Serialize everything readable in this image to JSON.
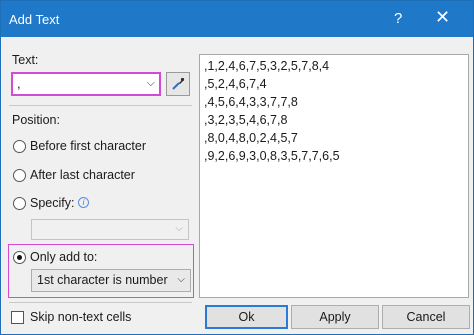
{
  "window": {
    "title": "Add Text",
    "help_symbol": "?",
    "close_symbol": "✕"
  },
  "text_section": {
    "label": "Text:",
    "value": ",",
    "dropdown_arrow": "⌵"
  },
  "position_section": {
    "label": "Position:",
    "options": [
      {
        "label": "Before first character",
        "checked": false
      },
      {
        "label": "After last character",
        "checked": false
      },
      {
        "label": "Specify:",
        "checked": false
      },
      {
        "label": "Only add to:",
        "checked": true
      }
    ],
    "specify_value": "",
    "only_add_to_value": "1st character is number"
  },
  "skip_non_text": {
    "label": "Skip non-text cells",
    "checked": false
  },
  "preview": {
    "lines": [
      ",1,2,4,6,7,5,3,2,5,7,8,4",
      ",5,2,4,6,7,4",
      ",4,5,6,4,3,3,7,7,8",
      ",3,2,3,5,4,6,7,8",
      ",8,0,4,8,0,2,4,5,7",
      ",9,2,6,9,3,0,8,3,5,7,7,6,5"
    ]
  },
  "buttons": {
    "ok": "Ok",
    "apply": "Apply",
    "cancel": "Cancel"
  },
  "colors": {
    "titlebar": "#1f78c8",
    "highlight": "#d24ad6",
    "dialog_bg": "#f0f0f0"
  },
  "icons": {
    "picker": "eyedropper-icon",
    "info": "info-icon"
  }
}
